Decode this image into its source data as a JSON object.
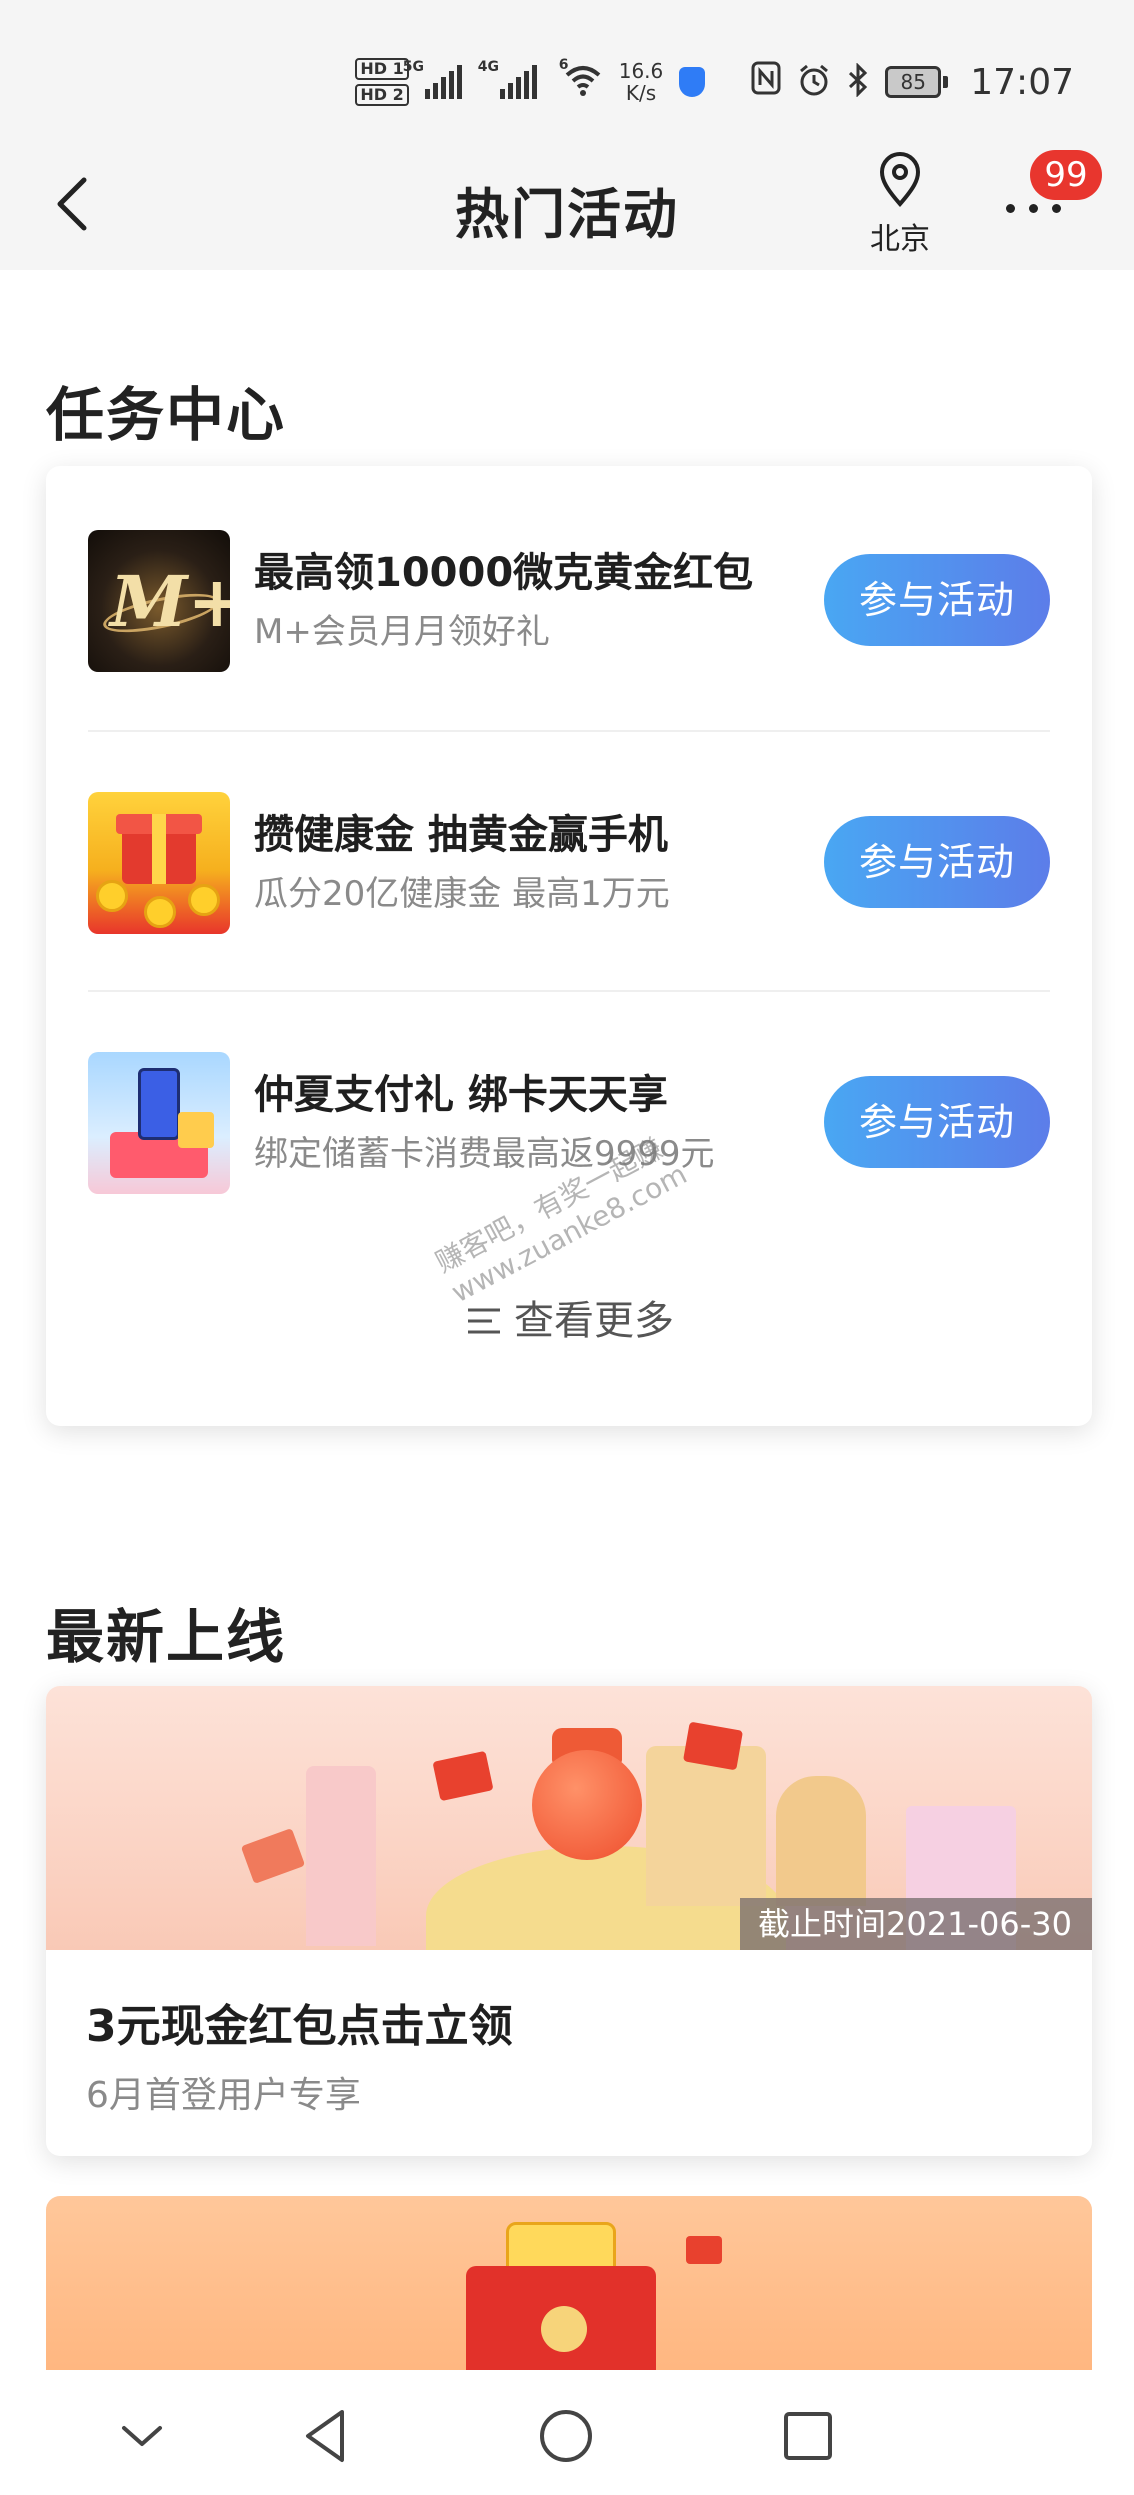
{
  "status_bar": {
    "hd1": "HD 1",
    "hd2": "HD 2",
    "net1": "5G",
    "net2": "4G",
    "wifi_gen": "6",
    "speed_value": "16.6",
    "speed_unit": "K/s",
    "battery": "85",
    "time": "17:07"
  },
  "navbar": {
    "title": "热门活动",
    "location": "北京",
    "badge_count": "99"
  },
  "task_center": {
    "heading": "任务中心",
    "items": [
      {
        "title": "最高领10000微克黄金红包",
        "subtitle": "M+会员月月领好礼",
        "button": "参与活动",
        "thumb_text": "M+"
      },
      {
        "title": "攒健康金 抽黄金赢手机",
        "subtitle": "瓜分20亿健康金 最高1万元",
        "button": "参与活动"
      },
      {
        "title": "仲夏支付礼 绑卡天天享",
        "subtitle": "绑定储蓄卡消费最高返9999元",
        "button": "参与活动"
      }
    ],
    "see_more": "查看更多"
  },
  "new_online": {
    "heading": "最新上线",
    "card": {
      "deadline": "截止时间2021-06-30",
      "title": "3元现金红包点击立领",
      "subtitle": "6月首登用户专享"
    }
  },
  "watermark": {
    "line1": "赚客吧，有奖一起赚",
    "line2": "www.zuanke8.com"
  },
  "colors": {
    "button_gradient_start": "#49a7f3",
    "button_gradient_end": "#5c7de9",
    "badge": "#e8362e"
  }
}
